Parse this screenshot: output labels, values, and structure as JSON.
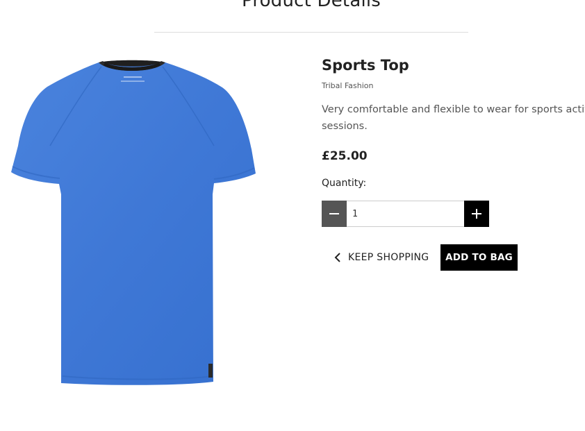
{
  "header": {
    "title": "Product Details"
  },
  "product": {
    "name": "Sports Top",
    "brand": "Tribal Fashion",
    "description": "Very comfortable and flexible to wear for sports activities sessions.",
    "price": "£25.00",
    "image": {
      "subject": "blue marl crew-neck t-shirt",
      "color": "#3f78d6"
    }
  },
  "quantity": {
    "label": "Quantity:",
    "value": "1",
    "decrement_icon": "minus-icon",
    "increment_icon": "plus-icon"
  },
  "actions": {
    "keep_shopping_label": "KEEP SHOPPING",
    "keep_shopping_icon": "chevron-left-icon",
    "add_to_bag_label": "ADD TO BAG"
  },
  "colors": {
    "primary_button": "#000000",
    "secondary_button": "#555555",
    "divider": "#dddddd"
  }
}
